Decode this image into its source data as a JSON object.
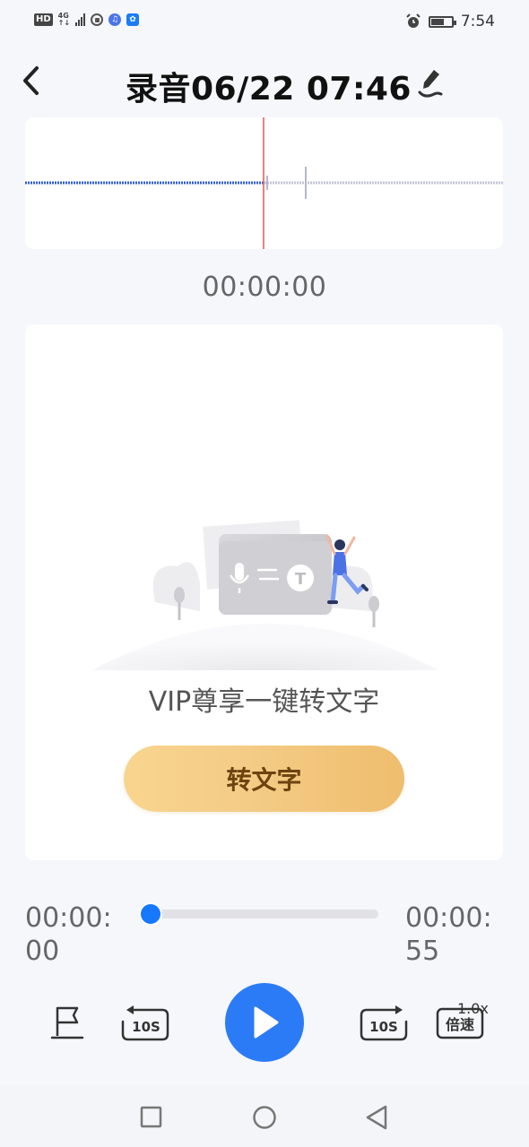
{
  "status_bar": {
    "network": "4G",
    "hd": "HD",
    "time": "7:54",
    "icons": [
      "signal-icon",
      "record-icon",
      "music-icon",
      "bulb-icon",
      "alarm-icon",
      "battery-icon"
    ]
  },
  "header": {
    "title": "录音06/22 07:46",
    "back_icon": "back-chevron-icon",
    "edit_icon": "edit-pen-icon"
  },
  "waveform": {
    "played_color": "#2f5fd0",
    "unplayed_color": "#c0c4d6",
    "playhead_color": "#e85555"
  },
  "current_time": "00:00:00",
  "conversion": {
    "promo_text": "VIP尊享一键转文字",
    "button_label": "转文字"
  },
  "player": {
    "elapsed": "00:00:00",
    "total": "00:00:55",
    "progress": 0,
    "speed": "1.0x",
    "speed_button": "倍速",
    "rewind_label": "10S",
    "forward_label": "10S",
    "accent": "#2c7bf6"
  },
  "nav": {
    "recent": "square-icon",
    "home": "circle-icon",
    "back": "triangle-back-icon"
  }
}
